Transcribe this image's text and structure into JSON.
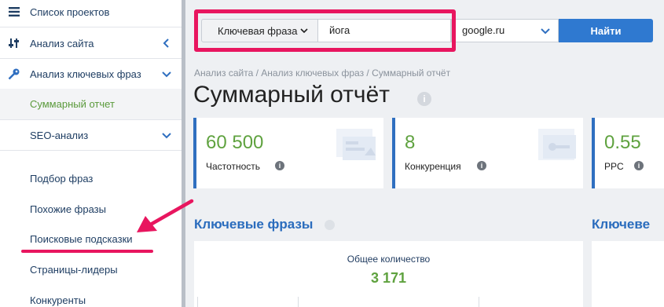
{
  "sidebar": {
    "items": [
      {
        "label": "Список проектов"
      },
      {
        "label": "Анализ сайта"
      },
      {
        "label": "Анализ ключевых фраз"
      },
      {
        "label": "Суммарный отчет"
      },
      {
        "label": "SEO-анализ"
      },
      {
        "label": "Подбор фраз"
      },
      {
        "label": "Похожие фразы"
      },
      {
        "label": "Поисковые подсказки"
      },
      {
        "label": "Страницы-лидеры"
      },
      {
        "label": "Конкуренты"
      }
    ]
  },
  "search": {
    "type_label": "Ключевая фраза",
    "query": "йога",
    "engine": "google.ru",
    "button_label": "Найти"
  },
  "breadcrumb": "Анализ сайта / Анализ ключевых фраз / Суммарный отчёт",
  "page_title": "Суммарный отчёт",
  "metrics": [
    {
      "value": "60 500",
      "label": "Частотность"
    },
    {
      "value": "8",
      "label": "Конкуренция"
    },
    {
      "value": "0.55",
      "label": "PPC"
    }
  ],
  "sections": {
    "keywords_title": "Ключевые фразы",
    "keywords_title_2": "Ключеве",
    "total_caption": "Общее количество",
    "total_value": "3 171"
  },
  "colors": {
    "accent": "#2f79d0",
    "highlight": "#e8165f",
    "value_green": "#5fa23f",
    "active_item": "#5a9a3b"
  }
}
